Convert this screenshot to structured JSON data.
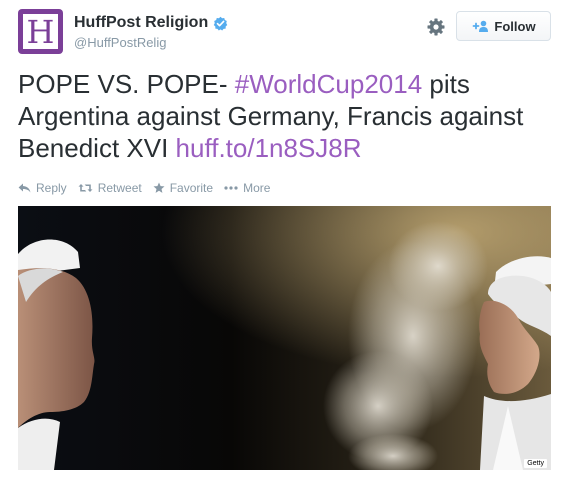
{
  "account": {
    "display_name": "HuffPost Religion",
    "screen_name": "@HuffPostRelig",
    "avatar_letter": "H",
    "avatar_color": "#7b3f98",
    "verified": true
  },
  "header": {
    "settings_icon": "gear-icon",
    "follow_label": "Follow"
  },
  "tweet": {
    "text_start": "POPE VS. POPE- ",
    "hashtag": "#WorldCup2014",
    "text_middle": " pits Argentina against Germany, Francis against Benedict XVI ",
    "url": "huff.to/1n8SJ8R"
  },
  "actions": {
    "reply": "Reply",
    "retweet": "Retweet",
    "favorite": "Favorite",
    "more": "More"
  },
  "media": {
    "credit": "Getty"
  },
  "colors": {
    "link": "#9a5ec0",
    "muted": "#8899a6",
    "text": "#292f33",
    "verified": "#55acee"
  }
}
